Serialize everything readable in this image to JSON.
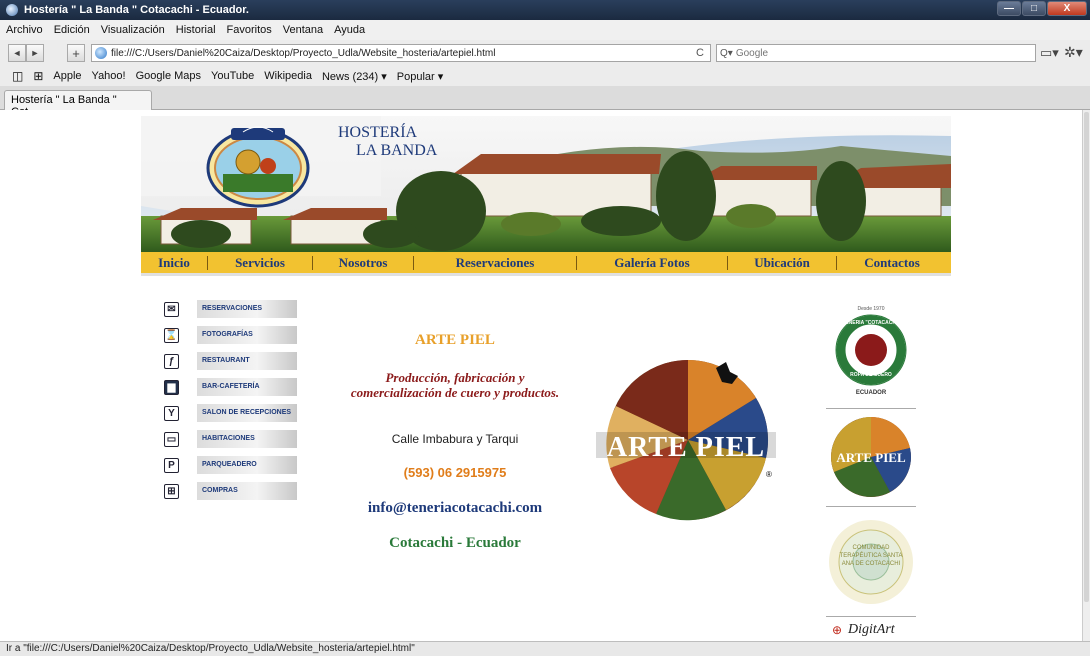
{
  "window": {
    "title": "Hostería \" La Banda \" Cotacachi - Ecuador.",
    "buttons": [
      "—",
      "□",
      "X"
    ]
  },
  "menu": [
    "Archivo",
    "Edición",
    "Visualización",
    "Historial",
    "Favoritos",
    "Ventana",
    "Ayuda"
  ],
  "toolbar": {
    "back": "◄",
    "forward": "►",
    "add": "+",
    "url": "file:///C:/Users/Daniel%20Caiza/Desktop/Proyecto_Udla/Website_hosteria/artepiel.html",
    "reload": "C",
    "search_placeholder": "Google",
    "search_prefix": "Q▾"
  },
  "bookmarks": [
    "Apple",
    "Yahoo!",
    "Google Maps",
    "YouTube",
    "Wikipedia",
    "News (234) ▾",
    "Popular ▾"
  ],
  "tab": {
    "label": "Hostería \" La Banda \" Cot..."
  },
  "site": {
    "name_line1": "HOSTERÍA",
    "name_line2": "LA BANDA",
    "logo_text": "Hostería \"La Banda\"",
    "nav": [
      "Inicio",
      "Servicios",
      "Nosotros",
      "Reservaciones",
      "Galería Fotos",
      "Ubicación",
      "Contactos"
    ],
    "sidebar": [
      {
        "label": "RESERVACIONES",
        "icon": "envelope-icon",
        "glyph": "✉"
      },
      {
        "label": "FOTOGRAFÍAS",
        "icon": "hourglass-icon",
        "glyph": "⌛"
      },
      {
        "label": "RESTAURANT",
        "icon": "fork-knife-icon",
        "glyph": "ƒ"
      },
      {
        "label": "BAR-CAFETERÍA",
        "icon": "cup-icon",
        "glyph": "▆"
      },
      {
        "label": "SALON DE RECEPCIONES",
        "icon": "cocktail-icon",
        "glyph": "Y"
      },
      {
        "label": "HABITACIONES",
        "icon": "bed-icon",
        "glyph": "▭"
      },
      {
        "label": "PARQUEADERO",
        "icon": "parking-icon",
        "glyph": "P"
      },
      {
        "label": "COMPRAS",
        "icon": "cart-icon",
        "glyph": "⊞"
      }
    ],
    "content": {
      "title": "ARTE PIEL",
      "description": "Producción, fabricación y comercialización de cuero y productos.",
      "address": "Calle Imbabura y Tarqui",
      "phone": "(593) 06 2915975",
      "email": "info@teneriacotacachi.com",
      "city": "Cotacachi - Ecuador"
    },
    "big_logo_text": "ARTE PIEL",
    "right_logos": {
      "teneria_top": "Desde 1970",
      "teneria_ring": "TENERIA \"COTACACHI\"",
      "teneria_bottom": "ROPA DE CUERO",
      "teneria_country": "ECUADOR",
      "artepiel": "ARTE PIEL",
      "comunidad": "COMUNIDAD TERAPÉUTICA SANTA ANA DE COTACACHI",
      "digitart": "DigitArt"
    }
  },
  "status": "Ir a \"file:///C:/Users/Daniel%20Caiza/Desktop/Proyecto_Udla/Website_hosteria/artepiel.html\""
}
